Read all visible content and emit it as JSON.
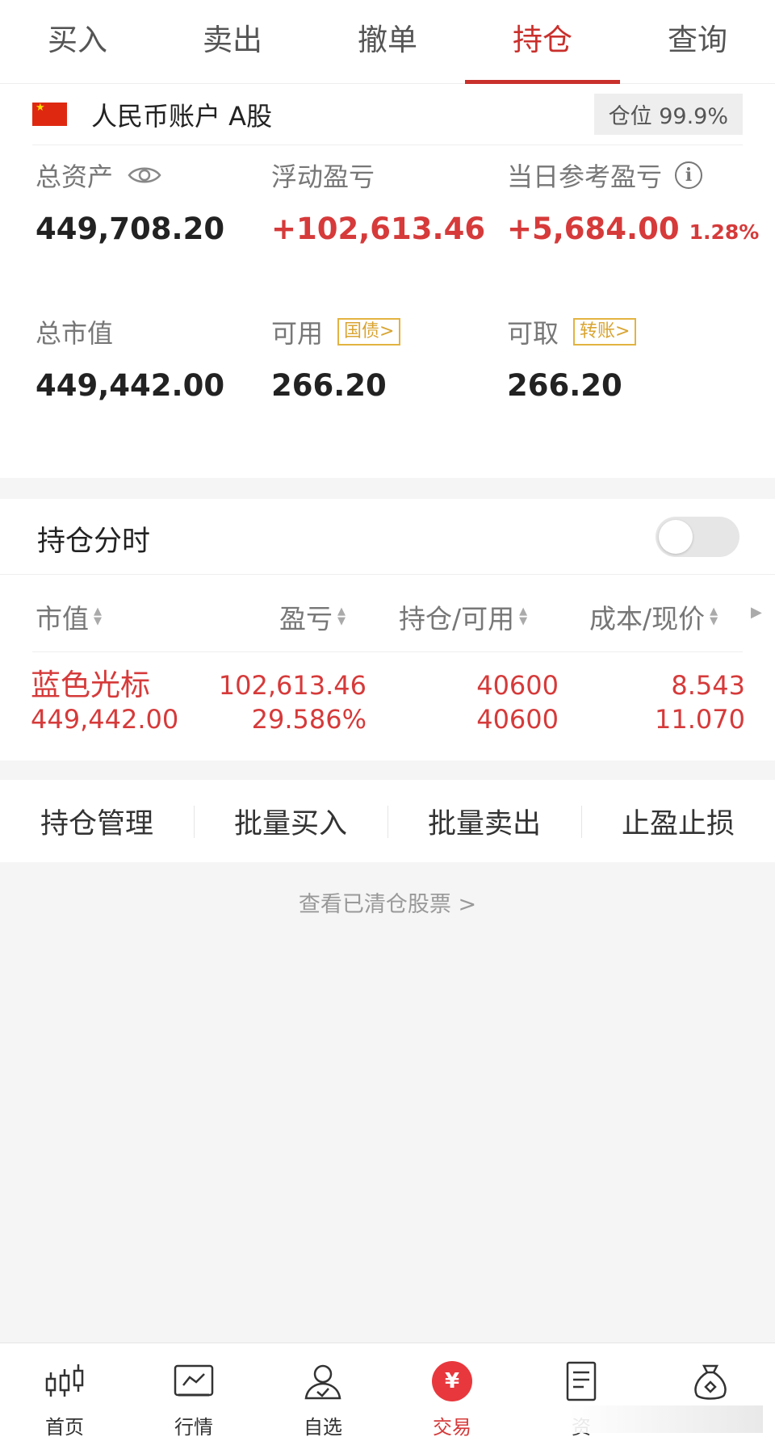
{
  "tabs": [
    {
      "label": "买入",
      "active": false
    },
    {
      "label": "卖出",
      "active": false
    },
    {
      "label": "撤单",
      "active": false
    },
    {
      "label": "持仓",
      "active": true
    },
    {
      "label": "查询",
      "active": false
    }
  ],
  "account": {
    "name": "人民币账户 A股",
    "position_ratio": "仓位 99.9%",
    "flag_icon": "china-flag-icon"
  },
  "metrics": {
    "total_assets": {
      "label": "总资产",
      "value": "449,708.20"
    },
    "floating_pnl": {
      "label": "浮动盈亏",
      "value": "+102,613.46"
    },
    "daily_pnl": {
      "label": "当日参考盈亏",
      "value": "+5,684.00",
      "percent": "1.28%"
    },
    "market_value": {
      "label": "总市值",
      "value": "449,442.00"
    },
    "available": {
      "label": "可用",
      "value": "266.20",
      "tag": "国债>"
    },
    "withdrawable": {
      "label": "可取",
      "value": "266.20",
      "tag": "转账>"
    }
  },
  "holdings": {
    "title": "持仓分时",
    "toggle_on": false,
    "columns": [
      "市值",
      "盈亏",
      "持仓/可用",
      "成本/现价"
    ],
    "rows": [
      {
        "name": "蓝色光标",
        "market_value": "449,442.00",
        "pnl": "102,613.46",
        "pnl_pct": "29.586%",
        "position": "40600",
        "available": "40600",
        "cost": "8.543",
        "price": "11.070"
      }
    ]
  },
  "actions": [
    "持仓管理",
    "批量买入",
    "批量卖出",
    "止盈止损"
  ],
  "cleared_link": "查看已清仓股票 >",
  "bottom_nav": [
    {
      "label": "首页",
      "icon": "candlestick-icon",
      "active": false
    },
    {
      "label": "行情",
      "icon": "chart-trend-icon",
      "active": false
    },
    {
      "label": "自选",
      "icon": "user-check-icon",
      "active": false
    },
    {
      "label": "交易",
      "icon": "yuan-icon",
      "active": true
    },
    {
      "label": "资",
      "icon": "document-icon",
      "active": false
    },
    {
      "label": "",
      "icon": "money-bag-icon",
      "active": false
    }
  ],
  "colors": {
    "accent_red": "#d63a3a",
    "tag_gold": "#d9a431"
  }
}
